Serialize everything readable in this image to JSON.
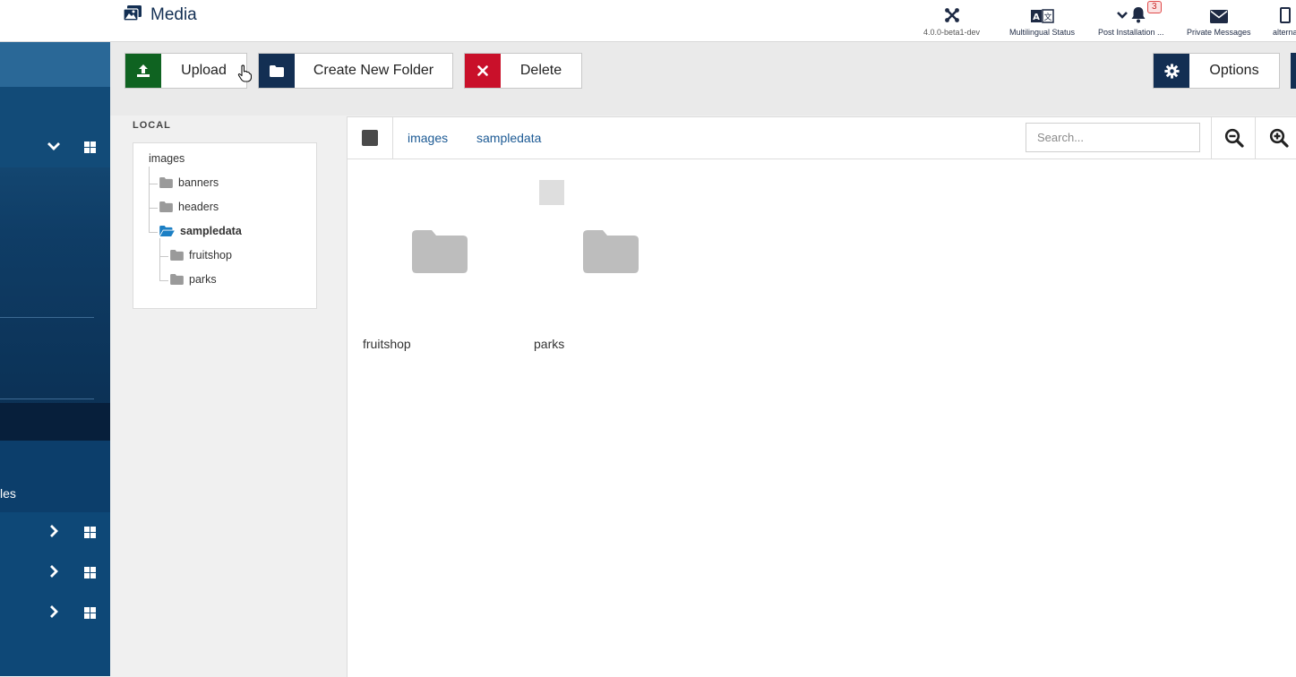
{
  "header": {
    "title": "Media",
    "version": "4.0.0-beta1-dev",
    "multilingual": "Multilingual Status",
    "post_install": "Post Installation ...",
    "post_install_badge": "3",
    "messages": "Private Messages",
    "user": "alterna"
  },
  "sidebar": {
    "partial_label": "les"
  },
  "toolbar": {
    "upload": "Upload",
    "create_folder": "Create New Folder",
    "delete": "Delete",
    "options": "Options"
  },
  "tree": {
    "section": "LOCAL",
    "root": "images",
    "nodes": [
      "banners",
      "headers",
      "sampledata"
    ],
    "children": [
      "fruitshop",
      "parks"
    ]
  },
  "browser": {
    "breadcrumb": [
      "images",
      "sampledata"
    ],
    "search_placeholder": "Search...",
    "items": [
      "fruitshop",
      "parks"
    ]
  },
  "colors": {
    "upload": "#0f6321",
    "create": "#132f53",
    "delete": "#c9102a",
    "options": "#132f53",
    "link": "#1c5a94"
  },
  "icons": {
    "header": [
      "media-icon",
      "joomla-icon",
      "language-icon",
      "bell-icon",
      "envelope-icon"
    ],
    "toolbar": [
      "upload-icon",
      "folder-icon",
      "close-icon",
      "gear-icon"
    ]
  }
}
